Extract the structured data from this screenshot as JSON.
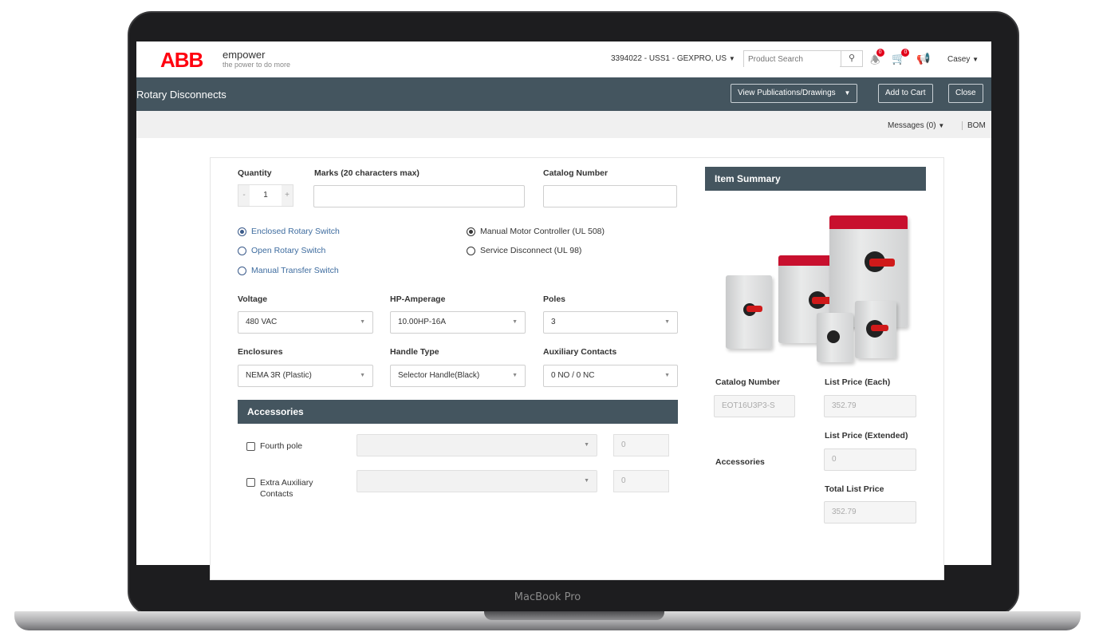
{
  "device": {
    "label": "MacBook Pro"
  },
  "header": {
    "logo": "ABB",
    "brand_name": "empower",
    "tagline": "the power to do more",
    "account": "3394022 - USS1 - GEXPRO, US",
    "search_placeholder": "Product Search",
    "notifications_count": "0",
    "cart_count": "0",
    "user": "Casey"
  },
  "titlebar": {
    "title": "Rotary Disconnects",
    "view_pubs": "View Publications/Drawings",
    "add_to_cart": "Add to Cart",
    "close": "Close"
  },
  "subbar": {
    "messages": "Messages (0)",
    "bom": "BOM"
  },
  "form": {
    "quantity_label": "Quantity",
    "quantity_value": "1",
    "minus": "-",
    "plus": "+",
    "marks_label": "Marks (20 characters max)",
    "catalog_label": "Catalog Number",
    "radios_left": [
      {
        "label": "Enclosed Rotary Switch",
        "checked": true
      },
      {
        "label": "Open Rotary Switch",
        "checked": false
      },
      {
        "label": "Manual Transfer Switch",
        "checked": false
      }
    ],
    "radios_right": [
      {
        "label": "Manual Motor Controller (UL 508)",
        "checked": true
      },
      {
        "label": "Service Disconnect (UL 98)",
        "checked": false
      }
    ],
    "voltage_label": "Voltage",
    "voltage_value": "480 VAC",
    "hp_label": "HP-Amperage",
    "hp_value": "10.00HP-16A",
    "poles_label": "Poles",
    "poles_value": "3",
    "enclosures_label": "Enclosures",
    "enclosures_value": "NEMA 3R (Plastic)",
    "handle_label": "Handle Type",
    "handle_value": "Selector Handle(Black)",
    "aux_label": "Auxiliary Contacts",
    "aux_value": "0 NO / 0 NC",
    "accessories_title": "Accessories",
    "accessories": [
      {
        "label": "Fourth pole",
        "qty": "0"
      },
      {
        "label": "Extra Auxiliary Contacts",
        "qty": "0"
      }
    ]
  },
  "summary": {
    "title": "Item Summary",
    "catalog_label": "Catalog Number",
    "catalog_value": "EOT16U3P3-S",
    "list_each_label": "List Price (Each)",
    "list_each_value": "352.79",
    "list_ext_label": "List Price (Extended)",
    "list_ext_value": "0",
    "accessories_label": "Accessories",
    "total_label": "Total List Price",
    "total_value": "352.79"
  },
  "colors": {
    "brand_red": "#ff000f",
    "header_bar": "#44555f",
    "link_blue": "#3e6c9f",
    "badge_red": "#e2001a"
  },
  "icons": [
    "search-icon",
    "bell-icon",
    "cart-icon",
    "megaphone-icon",
    "caret-down-icon"
  ]
}
